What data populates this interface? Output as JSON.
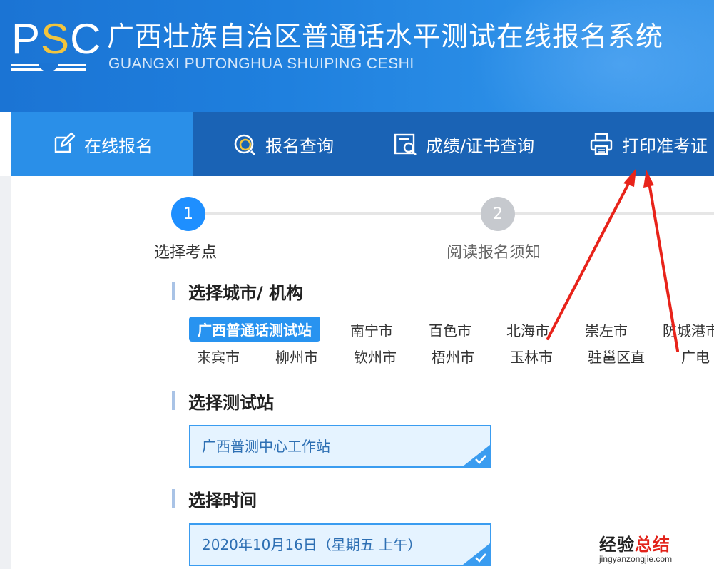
{
  "header": {
    "logo_letters": "PSC",
    "title": "广西壮族自治区普通话水平测试在线报名系统",
    "subtitle": "GUANGXI PUTONGHUA SHUIPING CESHI"
  },
  "nav": {
    "items": [
      {
        "label": "在线报名",
        "icon": "edit-icon",
        "active": true
      },
      {
        "label": "报名查询",
        "icon": "search-icon",
        "active": false
      },
      {
        "label": "成绩/证书查询",
        "icon": "certificate-search-icon",
        "active": false
      },
      {
        "label": "打印准考证",
        "icon": "printer-icon",
        "active": false
      }
    ]
  },
  "steps": [
    {
      "number": "1",
      "label": "选择考点",
      "active": true
    },
    {
      "number": "2",
      "label": "阅读报名须知",
      "active": false
    }
  ],
  "sections": {
    "city": {
      "title": "选择城市/ 机构",
      "selected": "广西普通话测试站",
      "cities_row1": [
        "广西普通话测试站",
        "南宁市",
        "百色市",
        "北海市",
        "崇左市",
        "防城港市"
      ],
      "cities_row2": [
        "来宾市",
        "柳州市",
        "钦州市",
        "梧州市",
        "玉林市",
        "驻邕区直",
        "广电"
      ]
    },
    "station": {
      "title": "选择测试站",
      "value": "广西普测中心工作站"
    },
    "time": {
      "title": "选择时间",
      "value": "2020年10月16日（星期五 上午）"
    }
  },
  "watermark": {
    "main_black": "经验",
    "main_red": "总结",
    "url": "jingyanzongjie.com"
  },
  "colors": {
    "header_blue": "#1f80de",
    "nav_blue": "#1a63b5",
    "nav_active": "#2a8fe8",
    "step_active": "#1e8fff",
    "selected_bg": "#e5f3ff",
    "arrow_red": "#e8231a"
  }
}
